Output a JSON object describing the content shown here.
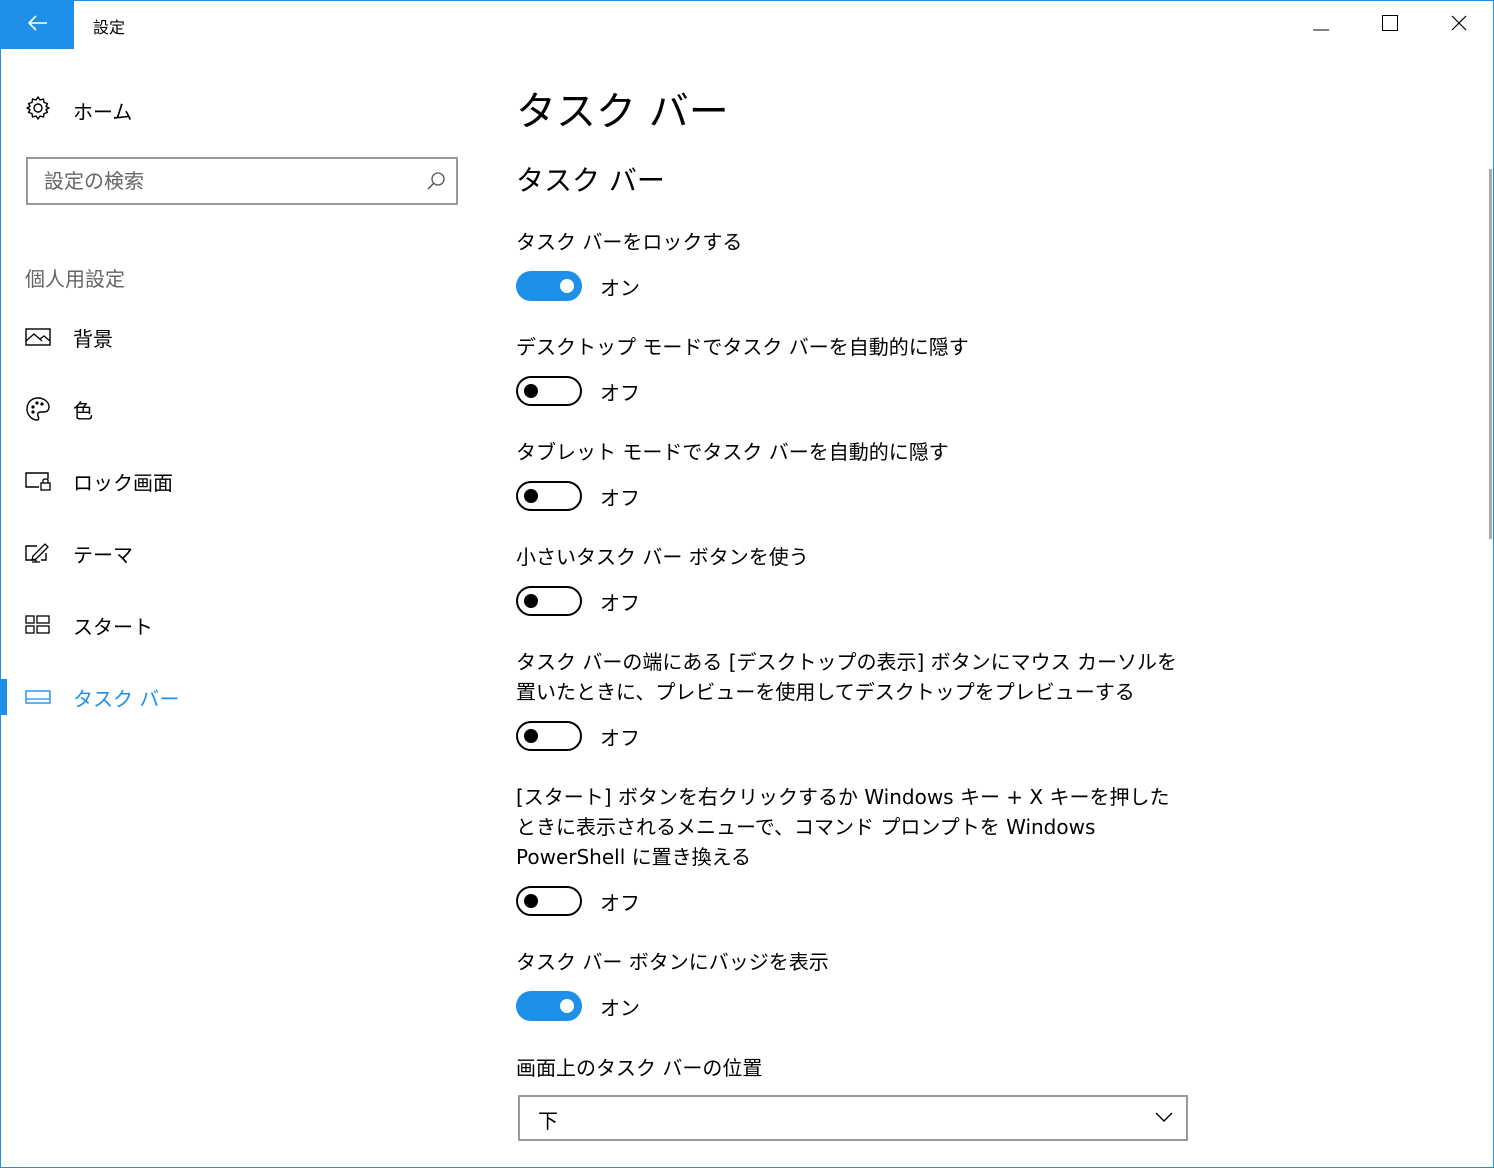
{
  "window": {
    "title": "設定"
  },
  "sidebar": {
    "home_label": "ホーム",
    "search_placeholder": "設定の検索",
    "section_header": "個人用設定",
    "items": [
      {
        "label": "背景",
        "icon": "picture-icon",
        "active": false
      },
      {
        "label": "色",
        "icon": "palette-icon",
        "active": false
      },
      {
        "label": "ロック画面",
        "icon": "lock-screen-icon",
        "active": false
      },
      {
        "label": "テーマ",
        "icon": "theme-icon",
        "active": false
      },
      {
        "label": "スタート",
        "icon": "start-tiles-icon",
        "active": false
      },
      {
        "label": "タスク バー",
        "icon": "taskbar-icon",
        "active": true
      }
    ]
  },
  "main": {
    "page_title": "タスク バー",
    "group_title": "タスク バー",
    "settings": [
      {
        "title": "タスク バーをロックする",
        "state": "オン",
        "on": true
      },
      {
        "title": "デスクトップ モードでタスク バーを自動的に隠す",
        "state": "オフ",
        "on": false
      },
      {
        "title": "タブレット モードでタスク バーを自動的に隠す",
        "state": "オフ",
        "on": false
      },
      {
        "title": "小さいタスク バー ボタンを使う",
        "state": "オフ",
        "on": false
      },
      {
        "title": "タスク バーの端にある [デスクトップの表示] ボタンにマウス カーソルを置いたときに、プレビューを使用してデスクトップをプレビューする",
        "state": "オフ",
        "on": false
      },
      {
        "title": "[スタート] ボタンを右クリックするか Windows キー + X キーを押したときに表示されるメニューで、コマンド プロンプトを Windows PowerShell に置き換える",
        "state": "オフ",
        "on": false
      },
      {
        "title": "タスク バー ボタンにバッジを表示",
        "state": "オン",
        "on": true
      }
    ],
    "position_label": "画面上のタスク バーの位置",
    "position_value": "下"
  },
  "colors": {
    "accent": "#1e90e8",
    "text": "#000000",
    "muted": "#666666"
  }
}
